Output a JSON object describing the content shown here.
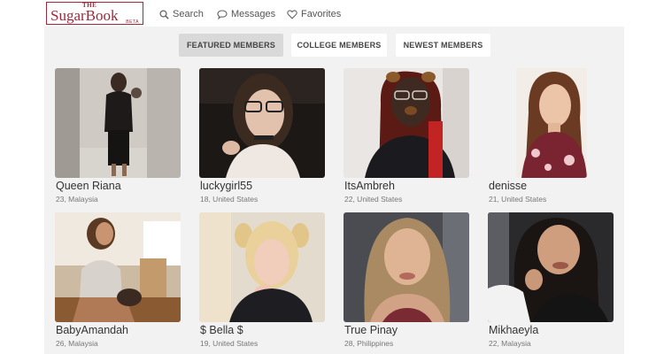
{
  "logo": {
    "the": "THE",
    "name": "SugarBook",
    "beta": "BETA"
  },
  "nav": {
    "search": "Search",
    "messages": "Messages",
    "favorites": "Favorites"
  },
  "tabs": [
    {
      "label": "FEATURED MEMBERS",
      "active": true
    },
    {
      "label": "COLLEGE MEMBERS",
      "active": false
    },
    {
      "label": "NEWEST MEMBERS",
      "active": false
    }
  ],
  "members": [
    {
      "name": "Queen Riana",
      "meta": "23, Malaysia"
    },
    {
      "name": "luckygirl55",
      "meta": "18, United States"
    },
    {
      "name": "ItsAmbreh",
      "meta": "22, United States"
    },
    {
      "name": "denisse",
      "meta": "21, United States"
    },
    {
      "name": "BabyAmandah",
      "meta": "26, Malaysia"
    },
    {
      "name": "$ Bella $",
      "meta": "19, United States"
    },
    {
      "name": "True Pinay",
      "meta": "28, Philippines"
    },
    {
      "name": "Mikhaeyla",
      "meta": "22, Malaysia"
    }
  ],
  "colors": {
    "brand": "#a0283a",
    "active_tab": "#d9d9d9",
    "page_bg": "#f2f2f2"
  },
  "icons": {
    "search": "search-icon",
    "messages": "chat-bubble-icon",
    "favorites": "heart-icon"
  }
}
